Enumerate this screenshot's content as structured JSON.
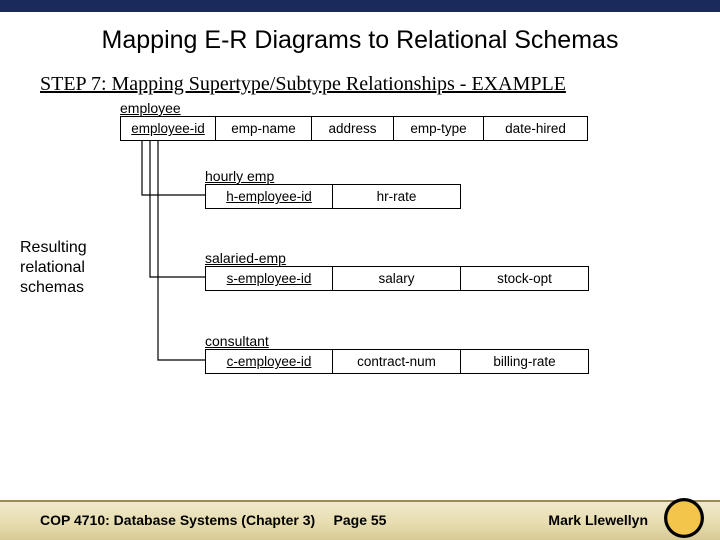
{
  "title": "Mapping E-R Diagrams to Relational Schemas",
  "step": "STEP 7:  Mapping Supertype/Subtype Relationships - EXAMPLE",
  "side_label": "Resulting relational schemas",
  "tables": {
    "employee": {
      "name": "employee",
      "cols": [
        "employee-id",
        "emp-name",
        "address",
        "emp-type",
        "date-hired"
      ]
    },
    "hourly": {
      "name": "hourly emp",
      "cols": [
        "h-employee-id",
        "hr-rate"
      ]
    },
    "salaried": {
      "name": "salaried-emp",
      "cols": [
        "s-employee-id",
        "salary",
        "stock-opt"
      ]
    },
    "consultant": {
      "name": "consultant",
      "cols": [
        "c-employee-id",
        "contract-num",
        "billing-rate"
      ]
    }
  },
  "footer": {
    "left": "COP 4710: Database Systems  (Chapter 3)",
    "center": "Page 55",
    "right": "Mark Llewellyn"
  },
  "logo_name": "ucf-pegasus"
}
